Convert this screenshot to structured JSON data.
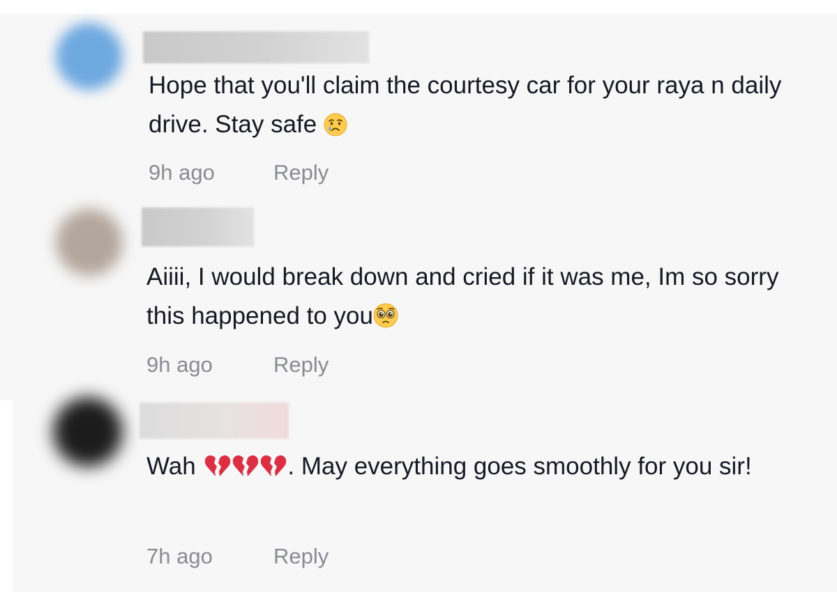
{
  "comments": [
    {
      "text_before": "Hope that you'll claim the courtesy car for your raya n daily drive. Stay safe",
      "emoji": "crying-face",
      "text_after": "",
      "time": "9h ago",
      "reply_label": "Reply",
      "avatar_color": "#6ea9e0"
    },
    {
      "text_before": "Aiiii, I would break down and cried if it was me, Im so sorry this happened to you",
      "emoji": "pleading-face",
      "text_after": "",
      "time": "9h ago",
      "reply_label": "Reply",
      "avatar_color": "#b3a69c"
    },
    {
      "text_before": "Wah",
      "emoji": "broken-heart x3",
      "text_after": ". May everything goes smoothly for you sir!",
      "time": "7h ago",
      "reply_label": "Reply",
      "avatar_color": "#1c1c1c"
    }
  ],
  "colors": {
    "background": "#f7f7f7",
    "text": "#161823",
    "meta": "#8a8b91",
    "broken_heart": "#e0245e"
  }
}
